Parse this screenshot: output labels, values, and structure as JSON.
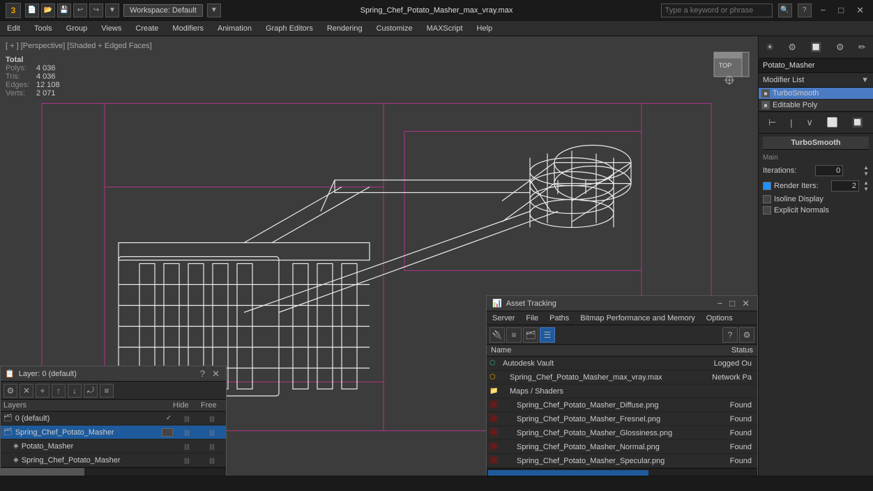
{
  "app": {
    "title": "Spring_Chef_Potato_Masher_max_vray.max",
    "logo": "3",
    "workspace": "Workspace: Default"
  },
  "titlebar": {
    "minimize": "−",
    "maximize": "□",
    "close": "✕",
    "search_placeholder": "Type a keyword or phrase"
  },
  "menubar": {
    "items": [
      "Edit",
      "Tools",
      "Group",
      "Views",
      "Create",
      "Modifiers",
      "Animation",
      "Graph Editors",
      "Rendering",
      "Customize",
      "MAXScript",
      "Help"
    ]
  },
  "viewport": {
    "label": "[ + ] [Perspective] [Shaded + Edged Faces]",
    "stats": {
      "total_label": "Total",
      "polys_label": "Polys:",
      "polys_value": "4 036",
      "tris_label": "Tris:",
      "tris_value": "4 036",
      "edges_label": "Edges:",
      "edges_value": "12 108",
      "verts_label": "Verts:",
      "verts_value": "2 071"
    }
  },
  "right_panel": {
    "object_name": "Potato_Masher",
    "modifier_list_label": "Modifier List",
    "modifiers": [
      {
        "name": "TurboSmooth",
        "selected": true
      },
      {
        "name": "Editable Poly",
        "selected": false
      }
    ],
    "turbosmooth": {
      "title": "TurboSmooth",
      "group_main": "Main",
      "iterations_label": "Iterations:",
      "iterations_value": "0",
      "render_iters_label": "Render Iters:",
      "render_iters_value": "2",
      "isoline_label": "Isoline Display",
      "explicit_label": "Explicit Normals"
    }
  },
  "layers_panel": {
    "title": "Layer: 0 (default)",
    "question": "?",
    "close": "✕",
    "header": {
      "layers": "Layers",
      "hide": "Hide",
      "freeze": "Free"
    },
    "layers": [
      {
        "name": "0 (default)",
        "indent": 0,
        "checked": true,
        "selected": false
      },
      {
        "name": "Spring_Chef_Potato_Masher",
        "indent": 0,
        "checked": false,
        "selected": true,
        "has_box": true
      },
      {
        "name": "Potato_Masher",
        "indent": 1,
        "checked": false,
        "selected": false
      },
      {
        "name": "Spring_Chef_Potato_Masher",
        "indent": 1,
        "checked": false,
        "selected": false
      }
    ]
  },
  "asset_panel": {
    "title": "Asset Tracking",
    "minimize": "−",
    "maximize": "□",
    "close": "✕",
    "menus": [
      "Server",
      "File",
      "Paths",
      "Bitmap Performance and Memory",
      "Options"
    ],
    "table_header": {
      "name": "Name",
      "status": "Status"
    },
    "rows": [
      {
        "name": "Autodesk Vault",
        "status": "Logged Ou",
        "indent": 0,
        "icon": "vault"
      },
      {
        "name": "Spring_Chef_Potato_Masher_max_vray.max",
        "status": "Network Pa",
        "indent": 1,
        "icon": "max"
      },
      {
        "name": "Maps / Shaders",
        "status": "",
        "indent": 1,
        "icon": "folder"
      },
      {
        "name": "Spring_Chef_Potato_Masher_Diffuse.png",
        "status": "Found",
        "indent": 2,
        "icon": "img"
      },
      {
        "name": "Spring_Chef_Potato_Masher_Fresnel.png",
        "status": "Found",
        "indent": 2,
        "icon": "img"
      },
      {
        "name": "Spring_Chef_Potato_Masher_Glossiness.png",
        "status": "Found",
        "indent": 2,
        "icon": "img"
      },
      {
        "name": "Spring_Chef_Potato_Masher_Normal.png",
        "status": "Found",
        "indent": 2,
        "icon": "img"
      },
      {
        "name": "Spring_Chef_Potato_Masher_Specular.png",
        "status": "Found",
        "indent": 2,
        "icon": "img"
      }
    ]
  },
  "statusbar": {
    "text": ""
  }
}
